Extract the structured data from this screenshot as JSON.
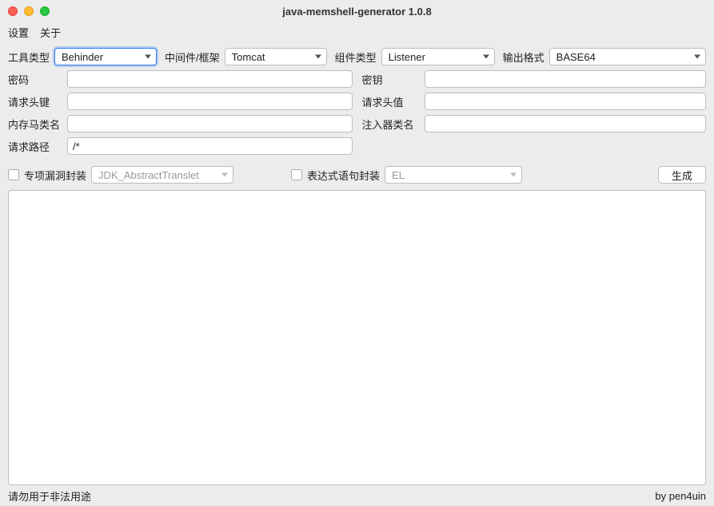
{
  "window": {
    "title": "java-memshell-generator 1.0.8"
  },
  "menu": {
    "settings": "设置",
    "about": "关于"
  },
  "toprow": {
    "tool_type_label": "工具类型",
    "tool_type_value": "Behinder",
    "middleware_label": "中间件/框架",
    "middleware_value": "Tomcat",
    "component_label": "组件类型",
    "component_value": "Listener",
    "output_format_label": "输出格式",
    "output_format_value": "BASE64"
  },
  "fields": {
    "password_label": "密码",
    "password_value": "",
    "secret_label": "密钥",
    "secret_value": "",
    "req_header_key_label": "请求头键",
    "req_header_key_value": "",
    "req_header_val_label": "请求头值",
    "req_header_val_value": "",
    "memshell_class_label": "内存马类名",
    "memshell_class_value": "",
    "injector_class_label": "注入器类名",
    "injector_class_value": "",
    "request_path_label": "请求路径",
    "request_path_value": "/*"
  },
  "options": {
    "vuln_wrap_label": "专项漏洞封装",
    "vuln_wrap_select": "JDK_AbstractTranslet",
    "expr_wrap_label": "表达式语句封装",
    "expr_wrap_select": "EL",
    "generate_label": "生成"
  },
  "status": {
    "left": "请勿用于非法用途",
    "right": "by pen4uin"
  }
}
